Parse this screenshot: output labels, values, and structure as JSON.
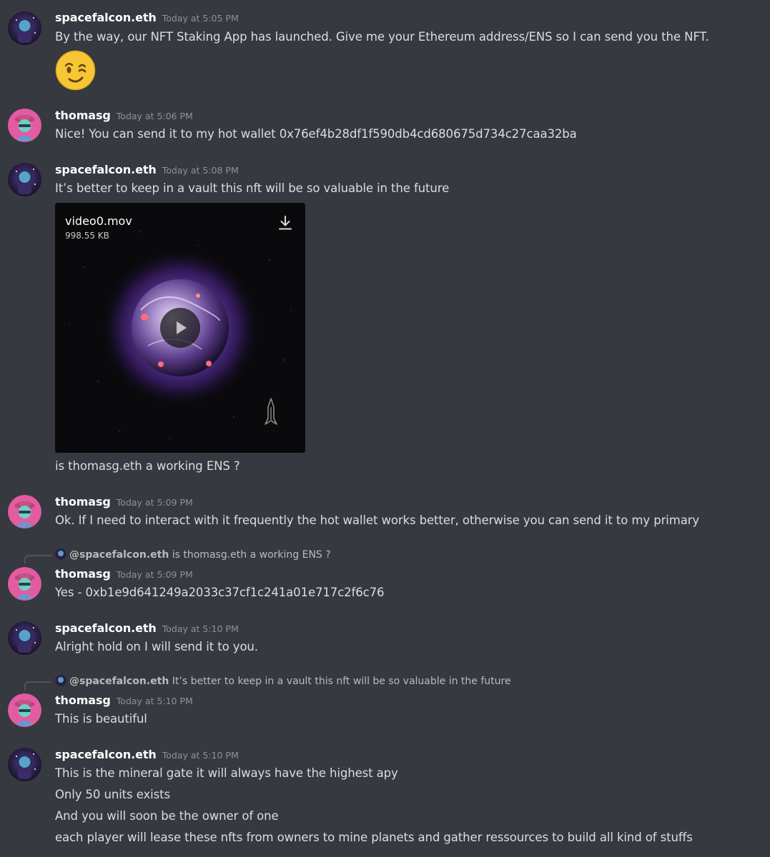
{
  "messages": [
    {
      "user": "spacefalcon.eth",
      "time": "Today at 5:05 PM",
      "lines": [
        "By the way, our NFT Staking App has launched. Give me your Ethereum address/ENS so I can send you the NFT."
      ],
      "emoji": "winking-face"
    },
    {
      "user": "thomasg",
      "time": "Today at 5:06 PM",
      "lines": [
        "Nice! You can send it to my hot wallet 0x76ef4b28df1f590db4cd680675d734c27caa32ba"
      ]
    },
    {
      "user": "spacefalcon.eth",
      "time": "Today at 5:08 PM",
      "lines": [
        "It’s better to keep in a vault this nft will be so valuable in the future"
      ],
      "attachment": {
        "filename": "video0.mov",
        "size": "998.55 KB"
      },
      "after_attachment": "is thomasg.eth a working ENS ?"
    },
    {
      "user": "thomasg",
      "time": "Today at 5:09 PM",
      "lines": [
        "Ok. If I need to interact with it frequently the hot wallet works better, otherwise you can send it to my primary"
      ]
    },
    {
      "reply_to": {
        "mention": "@spacefalcon.eth",
        "text": "is thomasg.eth a working ENS ?"
      },
      "user": "thomasg",
      "time": "Today at 5:09 PM",
      "lines": [
        "Yes - 0xb1e9d641249a2033c37cf1c241a01e717c2f6c76"
      ]
    },
    {
      "user": "spacefalcon.eth",
      "time": "Today at 5:10 PM",
      "lines": [
        "Alright hold on I will send it to you."
      ]
    },
    {
      "reply_to": {
        "mention": "@spacefalcon.eth",
        "text": "It’s better to keep in a vault this nft will be so valuable in the future"
      },
      "user": "thomasg",
      "time": "Today at 5:10 PM",
      "lines": [
        "This is beautiful"
      ]
    },
    {
      "user": "spacefalcon.eth",
      "time": "Today at 5:10 PM",
      "lines": [
        "This is the mineral gate it will always have the highest apy",
        "Only 50 units exists",
        "And you will soon be the owner of one",
        "each player will lease these nfts from owners to mine planets and gather ressources to build all kind of stuffs"
      ]
    }
  ],
  "colors": {
    "background": "#36393f",
    "username": "#ffffff",
    "timestamp": "#8e9297",
    "text": "#dcddde",
    "thomasg_avatar": "#e35ba0",
    "spacefalcon_avatar": "#1b1630"
  }
}
